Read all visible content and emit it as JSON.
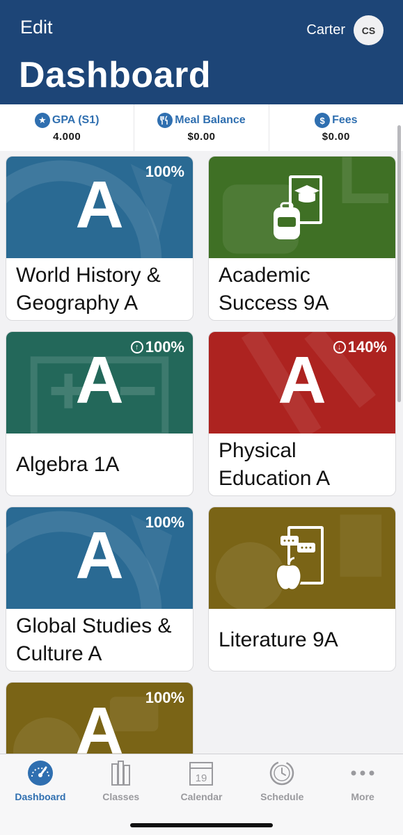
{
  "header": {
    "edit_label": "Edit",
    "user_name": "Carter",
    "avatar_initials": "CS",
    "title": "Dashboard"
  },
  "stats": [
    {
      "icon": "star-icon",
      "label": "GPA (S1)",
      "value": "4.000"
    },
    {
      "icon": "utensils-icon",
      "label": "Meal Balance",
      "value": "$0.00"
    },
    {
      "icon": "dollar-icon",
      "label": "Fees",
      "value": "$0.00"
    }
  ],
  "courses": [
    {
      "name": "World History & Geography A",
      "grade": "A",
      "percent": "100%",
      "trend": "",
      "color": "#2a6a93"
    },
    {
      "name": "Academic Success 9A",
      "grade": "",
      "percent": "",
      "trend": "",
      "color": "#3f7025",
      "icon": "backpack-book-icon"
    },
    {
      "name": "Algebra 1A",
      "grade": "A",
      "percent": "100%",
      "trend": "up",
      "color": "#23685a"
    },
    {
      "name": "Physical Education A",
      "grade": "A",
      "percent": "140%",
      "trend": "down",
      "color": "#ad2320"
    },
    {
      "name": "Global Studies & Culture A",
      "grade": "A",
      "percent": "100%",
      "trend": "",
      "color": "#2a6a93"
    },
    {
      "name": "Literature 9A",
      "grade": "",
      "percent": "",
      "trend": "",
      "color": "#7a6416",
      "icon": "book-apple-icon"
    },
    {
      "name": "",
      "grade": "A",
      "percent": "100%",
      "trend": "",
      "color": "#7a6416"
    }
  ],
  "tabs": [
    {
      "label": "Dashboard",
      "icon": "gauge-icon",
      "active": true
    },
    {
      "label": "Classes",
      "icon": "books-icon",
      "active": false
    },
    {
      "label": "Calendar",
      "icon": "calendar-icon",
      "active": false,
      "calendar_day": "19"
    },
    {
      "label": "Schedule",
      "icon": "clock-icon",
      "active": false
    },
    {
      "label": "More",
      "icon": "ellipsis-icon",
      "active": false
    }
  ]
}
